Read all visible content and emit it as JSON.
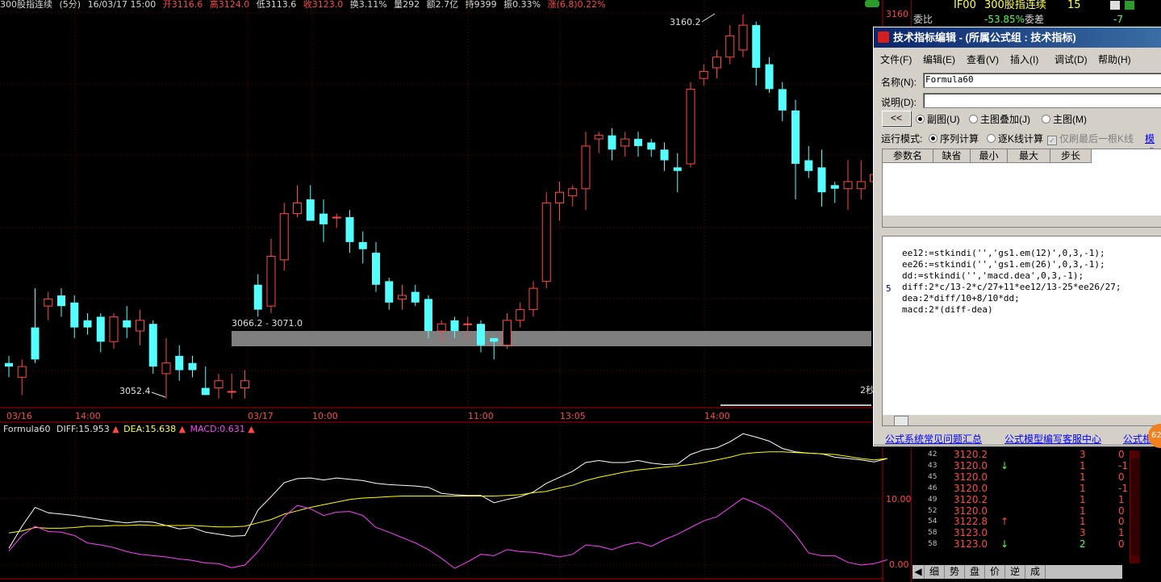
{
  "topbar": {
    "name": "300股指连续",
    "period": "(5分)",
    "datetime": "16/03/17 15:00",
    "open": "开3116.6",
    "high": "高3124.0",
    "low": "低3113.6",
    "close": "收3123.0",
    "turnover": "换3.11%",
    "volume": "量292",
    "amount": "额2.7亿",
    "hold": "持9399",
    "amplitude": "振0.33%",
    "change": "涨(6.8)0.22%"
  },
  "main_chart": {
    "price_labels": {
      "high_label": "3160.2",
      "low_label": "3052.4",
      "zone_label": "3066.2 - 3071.0",
      "axis_top": "3160",
      "partial_label": "2秒"
    },
    "time_labels": [
      "03/16",
      "14:00",
      "03/17",
      "10:00",
      "11:00",
      "13:05",
      "14:00"
    ]
  },
  "indicator": {
    "name": "Formula60",
    "diff_label": "DIFF:15.953",
    "dea_label": "DEA:15.638",
    "macd_label": "MACD:0.631",
    "axis_labels": [
      "10.00",
      "0.00"
    ],
    "colors": {
      "diff": "#ffffff",
      "dea": "#ffff00",
      "macd": "#ff40ff"
    }
  },
  "quote_header": {
    "code": "IF00",
    "name": "300股指连续",
    "num": "15",
    "weibi_label": "委比",
    "weibi_value": "-53.85%",
    "weicha_label": "委差",
    "weicha_value": "-7"
  },
  "ticks": [
    {
      "t": "42",
      "price": "3120.2",
      "arrow": "",
      "vol": "3",
      "chg": "0"
    },
    {
      "t": "43",
      "price": "3120.0",
      "arrow": "↓",
      "vol": "1",
      "chg": "-1"
    },
    {
      "t": "45",
      "price": "3120.0",
      "arrow": "",
      "vol": "1",
      "chg": "0"
    },
    {
      "t": "46",
      "price": "3120.0",
      "arrow": "",
      "vol": "1",
      "chg": "-1"
    },
    {
      "t": "49",
      "price": "3120.2",
      "arrow": "",
      "vol": "1",
      "chg": "1"
    },
    {
      "t": "52",
      "price": "3120.0",
      "arrow": "",
      "vol": "1",
      "chg": "0"
    },
    {
      "t": "54",
      "price": "3122.8",
      "arrow": "↑",
      "vol": "1",
      "chg": "0"
    },
    {
      "t": "58",
      "price": "3123.0",
      "arrow": "",
      "vol": "3",
      "chg": "1"
    },
    {
      "t": "58",
      "price": "3123.0",
      "arrow": "↓",
      "vol": "2",
      "chg": "0"
    }
  ],
  "bottom_tabs": [
    "细",
    "势",
    "盘",
    "价",
    "逆",
    "成"
  ],
  "dialog": {
    "title": "技术指标编辑 - (所属公式组 : 技术指标)",
    "menu": [
      "文件(F)",
      "编辑(E)",
      "查看(V)",
      "插入(I)",
      "调试(D)",
      "帮助(H)"
    ],
    "name_label": "名称(N):",
    "name_value": "Formula60",
    "desc_label": "说明(D):",
    "desc_value": "",
    "back_button": "<<",
    "radio_sub": "副图(U)",
    "radio_overlay": "主图叠加(J)",
    "radio_main": "主图(M)",
    "mode_label": "运行模式:",
    "mode_seq": "序列计算",
    "mode_each": "逐K线计算",
    "mode_last": "仅刷最后一根K线",
    "mode_more": "模式",
    "param_headers": [
      "参数名",
      "缺省",
      "最小",
      "最大",
      "步长"
    ],
    "code_line_no": "5",
    "code_lines": [
      "ee12:=stkindi('','gs1.em(12)',0,3,-1);",
      "ee26:=stkindi('','gs1.em(26)',0,3,-1);",
      "dd:=stkindi('','macd.dea',0,3,-1);",
      "diff:2*c/13-2*c/27+11*ee12/13-25*ee26/27;",
      "dea:2*diff/10+8/10*dd;",
      "macd:2*(diff-dea)"
    ],
    "links": [
      "公式系统常见问题汇总",
      "公式模型编写客服中心",
      "公式相"
    ]
  },
  "candles": [
    {
      "o": 3062,
      "h": 3064,
      "l": 3058,
      "c": 3061
    },
    {
      "o": 3058,
      "h": 3063,
      "l": 3053,
      "c": 3061
    },
    {
      "o": 3072,
      "h": 3083,
      "l": 3062,
      "c": 3063
    },
    {
      "o": 3078,
      "h": 3082,
      "l": 3074,
      "c": 3080
    },
    {
      "o": 3081,
      "h": 3083,
      "l": 3075,
      "c": 3078
    },
    {
      "o": 3079,
      "h": 3081,
      "l": 3069,
      "c": 3072
    },
    {
      "o": 3074,
      "h": 3076,
      "l": 3070,
      "c": 3072
    },
    {
      "o": 3075,
      "h": 3076,
      "l": 3065,
      "c": 3068
    },
    {
      "o": 3068,
      "h": 3076,
      "l": 3066,
      "c": 3075
    },
    {
      "o": 3074,
      "h": 3078,
      "l": 3069,
      "c": 3072
    },
    {
      "o": 3071,
      "h": 3077,
      "l": 3067,
      "c": 3074
    },
    {
      "o": 3073,
      "h": 3074,
      "l": 3059,
      "c": 3061
    },
    {
      "o": 3059,
      "h": 3069,
      "l": 3052,
      "c": 3062
    },
    {
      "o": 3064,
      "h": 3067,
      "l": 3057,
      "c": 3060
    },
    {
      "o": 3062,
      "h": 3064,
      "l": 3058,
      "c": 3060
    },
    {
      "o": 3055,
      "h": 3061,
      "l": 3053,
      "c": 3053
    },
    {
      "o": 3055,
      "h": 3059,
      "l": 3052,
      "c": 3057
    },
    {
      "o": 3054,
      "h": 3059,
      "l": 3052,
      "c": 3054
    },
    {
      "o": 3055,
      "h": 3060,
      "l": 3052,
      "c": 3057
    },
    {
      "o": 3084,
      "h": 3087,
      "l": 3075,
      "c": 3077
    },
    {
      "o": 3078,
      "h": 3097,
      "l": 3076,
      "c": 3092
    },
    {
      "o": 3091,
      "h": 3107,
      "l": 3088,
      "c": 3104
    },
    {
      "o": 3104,
      "h": 3112,
      "l": 3103,
      "c": 3107
    },
    {
      "o": 3108,
      "h": 3112,
      "l": 3103,
      "c": 3102
    },
    {
      "o": 3104,
      "h": 3108,
      "l": 3096,
      "c": 3101
    },
    {
      "o": 3103,
      "h": 3104,
      "l": 3100,
      "c": 3103
    },
    {
      "o": 3103,
      "h": 3105,
      "l": 3093,
      "c": 3096
    },
    {
      "o": 3096,
      "h": 3099,
      "l": 3090,
      "c": 3094
    },
    {
      "o": 3093,
      "h": 3096,
      "l": 3082,
      "c": 3084
    },
    {
      "o": 3085,
      "h": 3086,
      "l": 3077,
      "c": 3079
    },
    {
      "o": 3080,
      "h": 3084,
      "l": 3077,
      "c": 3081
    },
    {
      "o": 3082,
      "h": 3084,
      "l": 3078,
      "c": 3079
    },
    {
      "o": 3080,
      "h": 3081,
      "l": 3069,
      "c": 3071
    },
    {
      "o": 3071,
      "h": 3074,
      "l": 3068,
      "c": 3073
    },
    {
      "o": 3074,
      "h": 3075,
      "l": 3069,
      "c": 3071
    },
    {
      "o": 3073,
      "h": 3075,
      "l": 3069,
      "c": 3073
    },
    {
      "o": 3073,
      "h": 3074,
      "l": 3065,
      "c": 3067
    },
    {
      "o": 3069,
      "h": 3069,
      "l": 3063,
      "c": 3068
    },
    {
      "o": 3067,
      "h": 3076,
      "l": 3066,
      "c": 3074
    },
    {
      "o": 3074,
      "h": 3079,
      "l": 3072,
      "c": 3077
    },
    {
      "o": 3077,
      "h": 3085,
      "l": 3075,
      "c": 3083
    },
    {
      "o": 3085,
      "h": 3110,
      "l": 3083,
      "c": 3107
    },
    {
      "o": 3107,
      "h": 3113,
      "l": 3102,
      "c": 3110
    },
    {
      "o": 3109,
      "h": 3112,
      "l": 3106,
      "c": 3111
    },
    {
      "o": 3111,
      "h": 3127,
      "l": 3105,
      "c": 3123
    },
    {
      "o": 3125,
      "h": 3127,
      "l": 3121,
      "c": 3126
    },
    {
      "o": 3126,
      "h": 3128,
      "l": 3119,
      "c": 3122
    },
    {
      "o": 3123,
      "h": 3127,
      "l": 3120,
      "c": 3125
    },
    {
      "o": 3125,
      "h": 3127,
      "l": 3120,
      "c": 3123
    },
    {
      "o": 3124,
      "h": 3125,
      "l": 3120,
      "c": 3122
    },
    {
      "o": 3122,
      "h": 3124,
      "l": 3116,
      "c": 3119
    },
    {
      "o": 3117,
      "h": 3121,
      "l": 3110,
      "c": 3116
    },
    {
      "o": 3118,
      "h": 3141,
      "l": 3117,
      "c": 3139
    },
    {
      "o": 3142,
      "h": 3146,
      "l": 3140,
      "c": 3144
    },
    {
      "o": 3145,
      "h": 3150,
      "l": 3142,
      "c": 3148
    },
    {
      "o": 3148,
      "h": 3157,
      "l": 3146,
      "c": 3154
    },
    {
      "o": 3150,
      "h": 3160,
      "l": 3148,
      "c": 3157
    },
    {
      "o": 3157,
      "h": 3158,
      "l": 3140,
      "c": 3145
    },
    {
      "o": 3146,
      "h": 3148,
      "l": 3138,
      "c": 3139
    },
    {
      "o": 3139,
      "h": 3141,
      "l": 3130,
      "c": 3133
    },
    {
      "o": 3133,
      "h": 3136,
      "l": 3108,
      "c": 3118
    },
    {
      "o": 3119,
      "h": 3123,
      "l": 3114,
      "c": 3116
    },
    {
      "o": 3117,
      "h": 3122,
      "l": 3106,
      "c": 3110
    },
    {
      "o": 3112,
      "h": 3113,
      "l": 3107,
      "c": 3111
    },
    {
      "o": 3111,
      "h": 3119,
      "l": 3105,
      "c": 3113
    },
    {
      "o": 3111,
      "h": 3119,
      "l": 3108,
      "c": 3113
    },
    {
      "o": 3113,
      "h": 3116,
      "l": 3108,
      "c": 3115
    },
    {
      "o": 3116,
      "h": 3126,
      "l": 3113,
      "c": 3122
    }
  ],
  "indicator_series": {
    "diff": [
      2.5,
      5.8,
      8.6,
      7.8,
      7.6,
      7.4,
      7.1,
      6.8,
      6.5,
      6.3,
      6.5,
      6.4,
      5.9,
      5.4,
      5.6,
      4.9,
      4.6,
      4.3,
      4.4,
      8.2,
      10.2,
      12.3,
      12.9,
      13.0,
      12.7,
      13.0,
      12.8,
      12.6,
      12.2,
      12.0,
      11.9,
      11.8,
      11.6,
      10.7,
      10.5,
      10.4,
      10.4,
      9.3,
      9.8,
      10.2,
      10.9,
      12.2,
      13.1,
      14.0,
      15.3,
      15.6,
      15.3,
      15.3,
      15.6,
      15.2,
      15.0,
      15.1,
      16.5,
      17.2,
      17.5,
      18.4,
      19.6,
      19.1,
      18.5,
      17.4,
      16.9,
      16.7,
      16.6,
      16.1,
      15.9,
      15.7,
      15.4,
      15.9
    ],
    "dea": [
      4.8,
      5.1,
      5.6,
      5.5,
      5.5,
      5.6,
      5.8,
      5.8,
      5.9,
      5.9,
      6.0,
      5.9,
      5.9,
      5.9,
      5.9,
      5.8,
      5.7,
      5.7,
      5.8,
      6.3,
      6.8,
      7.6,
      8.1,
      8.6,
      9.0,
      9.4,
      9.8,
      10.0,
      10.1,
      10.2,
      10.3,
      10.3,
      10.3,
      10.3,
      10.3,
      10.3,
      10.3,
      10.3,
      10.4,
      10.5,
      10.8,
      11.0,
      11.5,
      11.9,
      12.6,
      13.1,
      13.5,
      13.9,
      14.2,
      14.4,
      14.6,
      14.8,
      15.0,
      15.3,
      15.7,
      16.1,
      16.6,
      16.8,
      16.9,
      16.9,
      16.8,
      16.7,
      16.6,
      16.5,
      16.2,
      15.9,
      15.7,
      15.9
    ],
    "macd": [
      2.1,
      4.4,
      5.8,
      5.0,
      4.9,
      4.4,
      3.3,
      3.0,
      2.6,
      2.0,
      1.6,
      1.4,
      1.2,
      0.9,
      0.7,
      0.3,
      0.2,
      -0.4,
      0.0,
      2.0,
      4.5,
      7.2,
      8.9,
      8.4,
      7.4,
      7.9,
      8.0,
      7.4,
      5.6,
      4.9,
      4.1,
      3.3,
      2.3,
      1.0,
      -0.5,
      0.5,
      1.6,
      1.4,
      2.3,
      2.0,
      1.9,
      1.6,
      1.2,
      1.6,
      3.0,
      2.8,
      2.3,
      3.0,
      3.4,
      2.8,
      3.8,
      4.6,
      5.6,
      6.6,
      7.2,
      8.6,
      10.0,
      9.2,
      8.2,
      6.6,
      4.5,
      1.8,
      1.4,
      1.4,
      0.4,
      0.0,
      0.2,
      0.8
    ]
  }
}
